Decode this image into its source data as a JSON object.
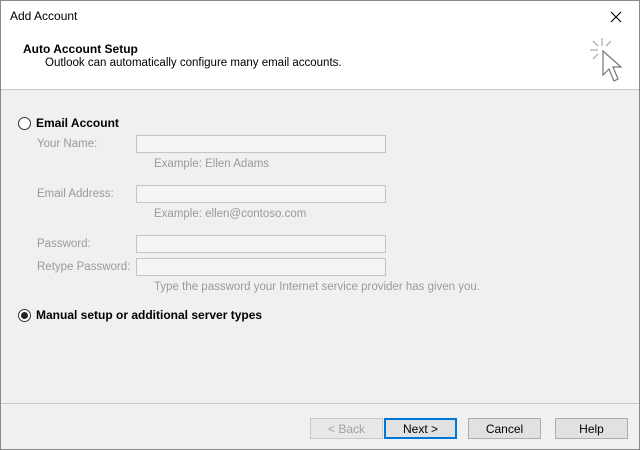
{
  "window": {
    "title": "Add Account"
  },
  "header": {
    "title": "Auto Account Setup",
    "subtitle": "Outlook can automatically configure many email accounts."
  },
  "options": {
    "email_account": {
      "label": "Email Account",
      "selected": false
    },
    "manual_setup": {
      "label": "Manual setup or additional server types",
      "selected": true
    }
  },
  "fields": {
    "name": {
      "label": "Your Name:",
      "value": "",
      "hint": "Example: Ellen Adams"
    },
    "email": {
      "label": "Email Address:",
      "value": "",
      "hint": "Example: ellen@contoso.com"
    },
    "password": {
      "label": "Password:",
      "value": ""
    },
    "retype": {
      "label": "Retype Password:",
      "value": ""
    },
    "password_hint": "Type the password your Internet service provider has given you."
  },
  "buttons": {
    "back": "< Back",
    "next": "Next >",
    "cancel": "Cancel",
    "help": "Help"
  },
  "icons": {
    "close": "close-icon",
    "header": "cursor-sparkle-icon"
  }
}
